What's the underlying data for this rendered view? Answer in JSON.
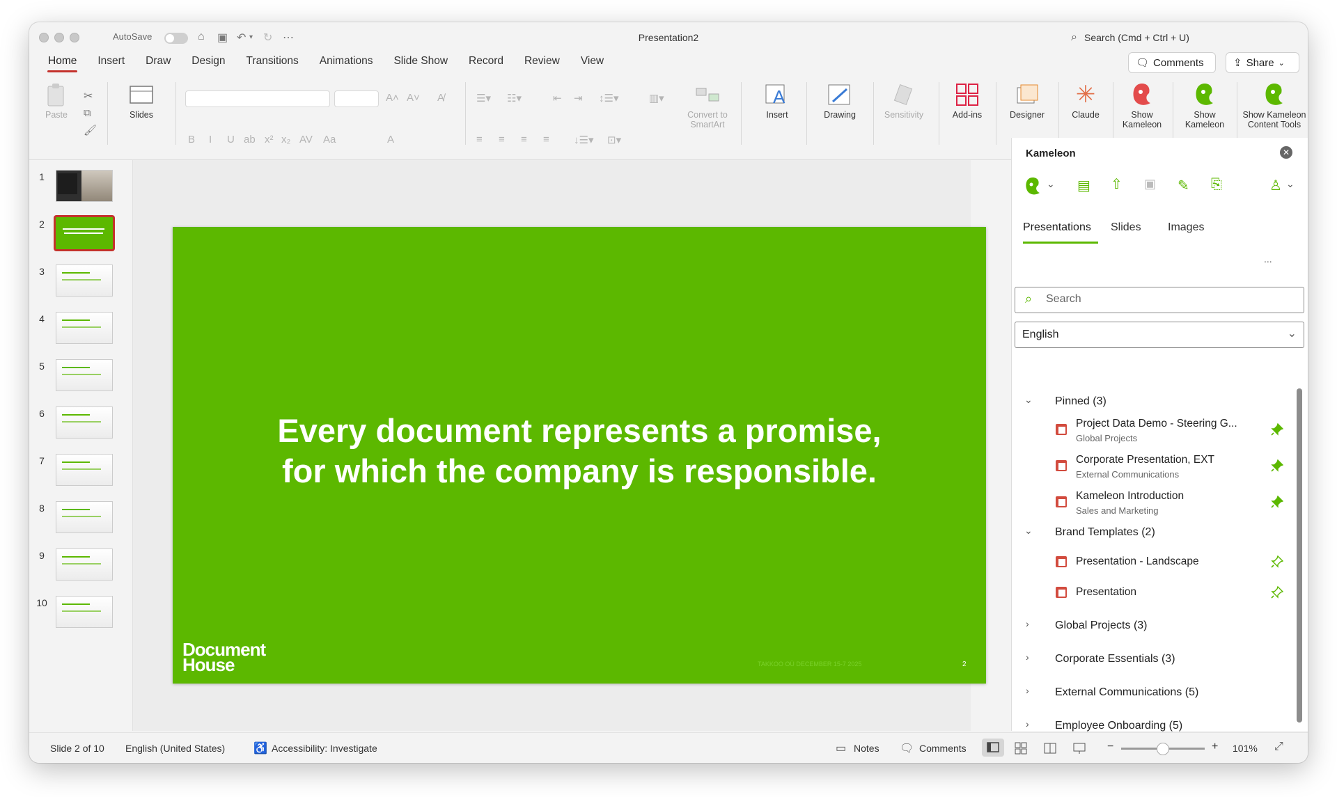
{
  "window": {
    "title": "Presentation2",
    "autosave_label": "AutoSave",
    "search_label": "Search (Cmd + Ctrl + U)",
    "comments_button": "Comments",
    "share_button": "Share"
  },
  "tabs": [
    "Home",
    "Insert",
    "Draw",
    "Design",
    "Transitions",
    "Animations",
    "Slide Show",
    "Record",
    "Review",
    "View"
  ],
  "active_tab": "Home",
  "ribbon": {
    "paste": "Paste",
    "slides": "Slides",
    "convert_line1": "Convert to",
    "convert_line2": "SmartArt",
    "insert": "Insert",
    "drawing": "Drawing",
    "sensitivity": "Sensitivity",
    "addins": "Add-ins",
    "designer": "Designer",
    "claude": "Claude",
    "show_kameleon_1_l1": "Show",
    "show_kameleon_1_l2": "Kameleon",
    "show_kameleon_2_l1": "Show",
    "show_kameleon_2_l2": "Kameleon",
    "show_tools_l1": "Show Kameleon",
    "show_tools_l2": "Content Tools",
    "format_glyphs": [
      "B",
      "I",
      "U",
      "ab",
      "x²",
      "x₂",
      "AV",
      "Aa",
      "A"
    ]
  },
  "thumbnails": [
    "1",
    "2",
    "3",
    "4",
    "5",
    "6",
    "7",
    "8",
    "9",
    "10"
  ],
  "selected_slide": 2,
  "slide": {
    "line1": "Every document represents a promise,",
    "line2": "for which the company is responsible.",
    "logo_line1": "Document",
    "logo_line2": "House",
    "footer": "TAKKOO OÜ DECEMBER 15-7 2025",
    "number": "2",
    "background": "#5cb800"
  },
  "pane": {
    "title": "Kameleon",
    "tabs": [
      "Presentations",
      "Slides",
      "Images"
    ],
    "more": "...",
    "search_placeholder": "Search",
    "language": "English",
    "pinned_label": "Pinned (3)",
    "pinned_items": [
      {
        "title": "Project Data Demo - Steering G...",
        "sub": "Global Projects"
      },
      {
        "title": "Corporate Presentation, EXT",
        "sub": "External Communications"
      },
      {
        "title": "Kameleon Introduction",
        "sub": "Sales and Marketing"
      }
    ],
    "brand_label": "Brand Templates (2)",
    "brand_items": [
      {
        "title": "Presentation - Landscape"
      },
      {
        "title": "Presentation"
      }
    ],
    "collapsed": [
      "Global Projects (3)",
      "Corporate Essentials (3)",
      "External Communications (5)",
      "Employee Onboarding (5)"
    ],
    "accent": "#5cb800"
  },
  "status": {
    "slide_of": "Slide 2 of 10",
    "language": "English (United States)",
    "accessibility": "Accessibility: Investigate",
    "notes": "Notes",
    "comments": "Comments",
    "zoom": "101%",
    "zoom_fraction": 0.5
  }
}
